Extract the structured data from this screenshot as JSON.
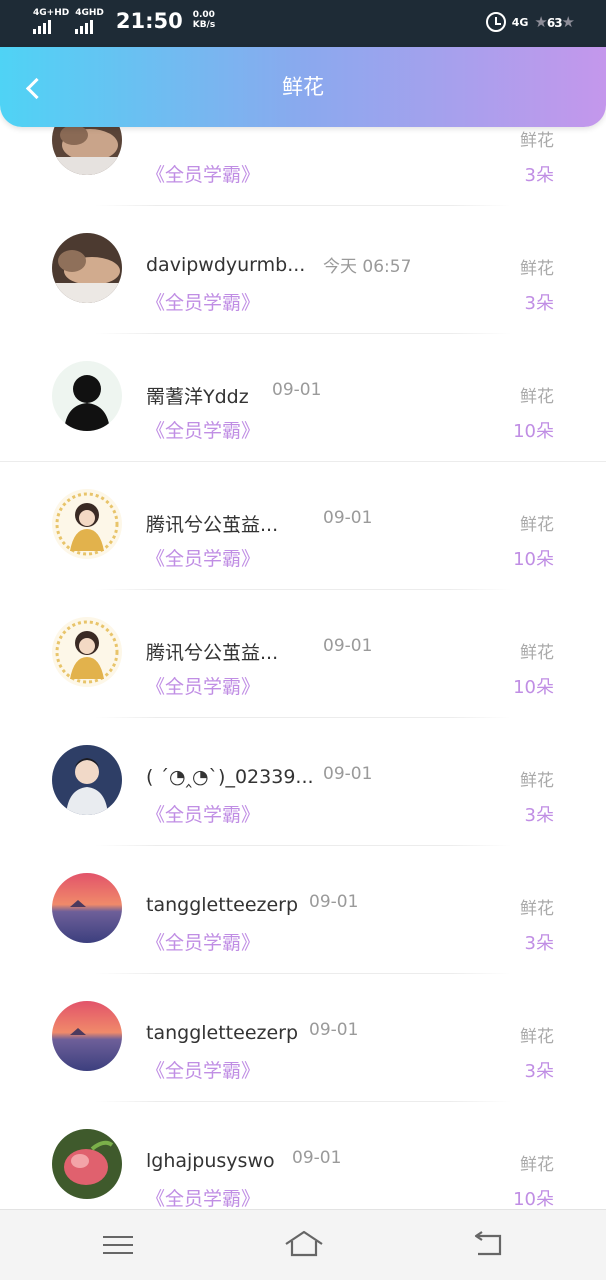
{
  "status_bar": {
    "net1": "4G+HD",
    "net2": "4GHD",
    "time": "21:50",
    "speed_value": "0.00",
    "speed_unit": "KB/s",
    "signal": "4G",
    "battery": "63"
  },
  "header": {
    "title": "鲜花"
  },
  "rows": [
    {
      "name": "",
      "date": "",
      "tag": "《全员学霸》",
      "flower": "鲜花",
      "count": "3朵"
    },
    {
      "name": "davipwdyurmb...",
      "date": "今天 06:57",
      "tag": "《全员学霸》",
      "flower": "鲜花",
      "count": "3朵"
    },
    {
      "name": "罱蓍洋Yddz",
      "date": "09-01",
      "tag": "《全员学霸》",
      "flower": "鲜花",
      "count": "10朵"
    },
    {
      "name": "腾讯兮公茧益...",
      "date": "09-01",
      "tag": "《全员学霸》",
      "flower": "鲜花",
      "count": "10朵"
    },
    {
      "name": "腾讯兮公茧益...",
      "date": "09-01",
      "tag": "《全员学霸》",
      "flower": "鲜花",
      "count": "10朵"
    },
    {
      "name": "( ´◔‸◔`)_02339...",
      "date": "09-01",
      "tag": "《全员学霸》",
      "flower": "鲜花",
      "count": "3朵"
    },
    {
      "name": "tanggletteezerp",
      "date": "09-01",
      "tag": "《全员学霸》",
      "flower": "鲜花",
      "count": "3朵"
    },
    {
      "name": "tanggletteezerp",
      "date": "09-01",
      "tag": "《全员学霸》",
      "flower": "鲜花",
      "count": "3朵"
    },
    {
      "name": "lghajpusyswo",
      "date": "09-01",
      "tag": "《全员学霸》",
      "flower": "鲜花",
      "count": "10朵"
    }
  ],
  "colors": {
    "accent": "#c08ee4",
    "header_start": "#4fd3f5",
    "header_end": "#c497ec"
  }
}
